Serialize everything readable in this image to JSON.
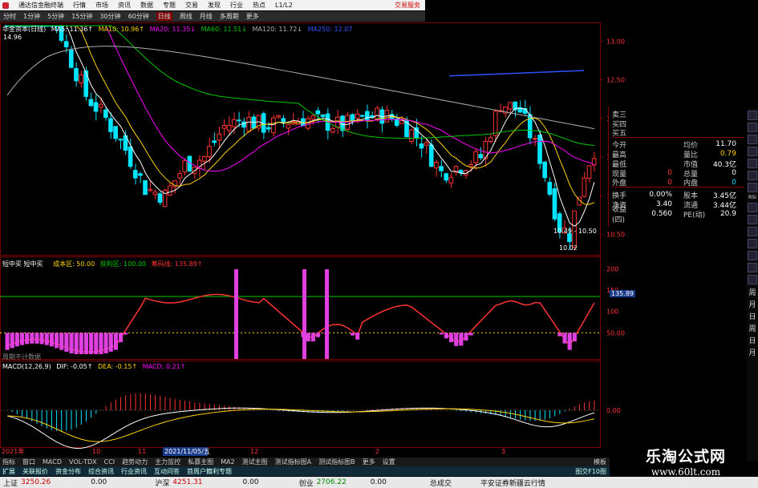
{
  "app": {
    "title": "通达信金融终端",
    "menus": [
      "行情",
      "市场",
      "资讯",
      "数据",
      "专题",
      "交易",
      "发现",
      "行业",
      "热点",
      "L1/L2"
    ],
    "trade_menu": "交易服务"
  },
  "periods": [
    "分时",
    "1分钟",
    "5分钟",
    "15分钟",
    "30分钟",
    "60分钟",
    "日线",
    "周线",
    "月线",
    "多周期",
    "更多"
  ],
  "active_period": "日线",
  "main_chart": {
    "legend": {
      "stock": "华金资本(日线)",
      "ma5": "MA5: 11.36↑",
      "ma10": "MA10: 10.96↑",
      "ma20": "MA20: 11.35↓",
      "ma60": "MA60: 11.51↓",
      "ma120": "MA120: 11.72↓",
      "ma250": "MA250: 12.07"
    },
    "high_label": "14.96",
    "low_label": "10.02",
    "range_label": "10.49 - 10.50",
    "price_axis": [
      "13.00",
      "12.50",
      "12.00",
      "11.50",
      "11.00",
      "10.50"
    ]
  },
  "indicator1": {
    "title": "短中买 短中买",
    "cost_label": "成本区: 50.00",
    "line1": "获利区: 100.00",
    "line2": "筹码线: 135.89↑",
    "axis": [
      "200",
      "150",
      "100",
      "50.00"
    ],
    "current": "135.89",
    "footnote": "周期不计数据"
  },
  "macd": {
    "title": "MACD(12,26,9)",
    "dif": "DIF: -0.05↑",
    "dea": "DEA: -0.15↑",
    "macd": "MACD: 0.21↑",
    "axis": [
      "0.00"
    ]
  },
  "time_axis": [
    "2021年",
    "10",
    "11",
    "2021/11/05/五",
    "12",
    "2",
    "3"
  ],
  "quote": {
    "sell": [
      "卖三",
      "买四",
      "买五"
    ],
    "rows": [
      {
        "l": "今开",
        "v": "",
        "l2": "均价",
        "v2": "11.70"
      },
      {
        "l": "最高",
        "v": "",
        "l2": "量比",
        "v2": "0.79"
      },
      {
        "l": "最低",
        "v": "",
        "l2": "市值",
        "v2": "40.3亿"
      },
      {
        "l": "现量",
        "v": "0",
        "l2": "总量",
        "v2": "0"
      },
      {
        "l": "外盘",
        "v": "0",
        "l2": "内盘",
        "v2": "0"
      }
    ],
    "rows2": [
      {
        "l": "换手",
        "v": "0.00%",
        "l2": "股本",
        "v2": "3.45亿"
      },
      {
        "l": "净资",
        "v": "3.40",
        "l2": "流通",
        "v2": "3.44亿"
      },
      {
        "l": "收益(四)",
        "v": "0.560",
        "l2": "PE(动)",
        "v2": "20.9"
      }
    ]
  },
  "vtoolbar": [
    "RSI",
    "周",
    "月",
    "日",
    "周",
    "日",
    "月"
  ],
  "tabs": [
    "指标",
    "窗口",
    "MACD",
    "VOL-TDX",
    "CCI",
    "趋势动力",
    "主力监控",
    "私募主图",
    "MA2",
    "测试主图",
    "测试指标图A",
    "测试指标图B",
    "更多",
    "设置"
  ],
  "tabs_right": "模板",
  "tabs2": [
    "扩展",
    "关联报价",
    "资金分布",
    "综合资讯",
    "行业资讯",
    "互动问答",
    "首周户籍利专题"
  ],
  "tabs2_right": "图交F10图",
  "status": {
    "sh_label": "上证",
    "sh_value": "3250.26",
    "sh_change": "0.00",
    "sz_label": "沪深",
    "sz_value": "4251.31",
    "sz_change": "0.00",
    "cy_label": "创业",
    "cy_value": "2706.22",
    "cy_change": "0.00",
    "vol_label": "总成交",
    "broker": "平安证券新疆云行情"
  },
  "watermark": {
    "title": "乐淘公式网",
    "url": "www.60lt.com"
  },
  "colors": {
    "up": "#ff3232",
    "down": "#00e5ff",
    "ma5": "#ffffff",
    "ma10": "#ffd200",
    "ma20": "#ff00ff",
    "ma60": "#00c800",
    "ma120": "#b0b0b0",
    "ma250": "#3050ff",
    "magenta": "#e040e0",
    "grid": "#800000"
  }
}
